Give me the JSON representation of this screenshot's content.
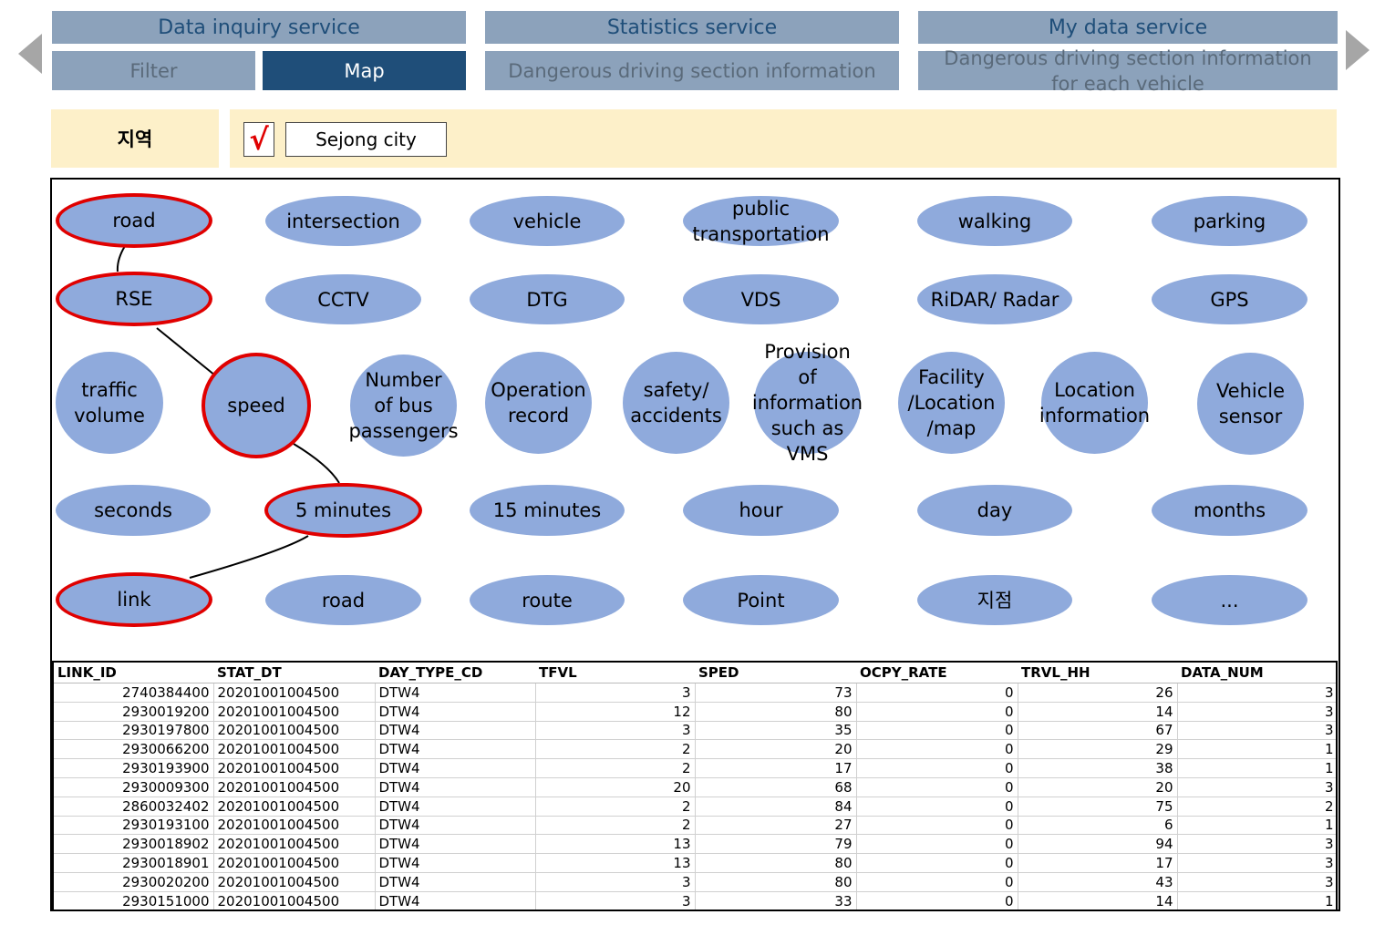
{
  "nav": {
    "main_tabs": [
      "Data inquiry service",
      "Statistics service",
      "My data service"
    ],
    "sub_tabs": {
      "filter": "Filter",
      "map": "Map",
      "dangerous": "Dangerous driving section information",
      "dangerous_vehicle": "Dangerous driving section information\nfor each vehicle"
    }
  },
  "region": {
    "label": "지역",
    "check_mark": "√",
    "city": "Sejong city"
  },
  "colors": {
    "node": "#8faadc",
    "selected_ring": "#e00000",
    "tab": "#8ca2bb",
    "active_tab": "#1f4e79",
    "region_bg": "#fdf0c9"
  },
  "nodes": {
    "row1": [
      "road",
      "intersection",
      "vehicle",
      "public\ntransportation",
      "walking",
      "parking"
    ],
    "row2": [
      "RSE",
      "CCTV",
      "DTG",
      "VDS",
      "RiDAR/ Radar",
      "GPS"
    ],
    "row3": [
      "traffic\nvolume",
      "speed",
      "Number\nof bus\npassengers",
      "Operation\nrecord",
      "safety/\naccidents",
      "Provision\nof information\nsuch as VMS",
      "Facility\n/Location\n/map",
      "Location\ninformation",
      "Vehicle\nsensor"
    ],
    "row4": [
      "seconds",
      "5 minutes",
      "15 minutes",
      "hour",
      "day",
      "months"
    ],
    "row5": [
      "link",
      "road",
      "route",
      "Point",
      "지점",
      "..."
    ]
  },
  "selected_path": [
    "road",
    "RSE",
    "speed",
    "5 minutes",
    "link"
  ],
  "table": {
    "columns": [
      "LINK_ID",
      "STAT_DT",
      "DAY_TYPE_CD",
      "TFVL",
      "SPED",
      "OCPY_RATE",
      "TRVL_HH",
      "DATA_NUM"
    ],
    "rows": [
      [
        "2740384400",
        "20201001004500",
        "DTW4",
        "3",
        "73",
        "0",
        "26",
        "3"
      ],
      [
        "2930019200",
        "20201001004500",
        "DTW4",
        "12",
        "80",
        "0",
        "14",
        "3"
      ],
      [
        "2930197800",
        "20201001004500",
        "DTW4",
        "3",
        "35",
        "0",
        "67",
        "3"
      ],
      [
        "2930066200",
        "20201001004500",
        "DTW4",
        "2",
        "20",
        "0",
        "29",
        "1"
      ],
      [
        "2930193900",
        "20201001004500",
        "DTW4",
        "2",
        "17",
        "0",
        "38",
        "1"
      ],
      [
        "2930009300",
        "20201001004500",
        "DTW4",
        "20",
        "68",
        "0",
        "20",
        "3"
      ],
      [
        "2860032402",
        "20201001004500",
        "DTW4",
        "2",
        "84",
        "0",
        "75",
        "2"
      ],
      [
        "2930193100",
        "20201001004500",
        "DTW4",
        "2",
        "27",
        "0",
        "6",
        "1"
      ],
      [
        "2930018902",
        "20201001004500",
        "DTW4",
        "13",
        "79",
        "0",
        "94",
        "3"
      ],
      [
        "2930018901",
        "20201001004500",
        "DTW4",
        "13",
        "80",
        "0",
        "17",
        "3"
      ],
      [
        "2930020200",
        "20201001004500",
        "DTW4",
        "3",
        "80",
        "0",
        "43",
        "3"
      ],
      [
        "2930151000",
        "20201001004500",
        "DTW4",
        "3",
        "33",
        "0",
        "14",
        "1"
      ]
    ]
  }
}
